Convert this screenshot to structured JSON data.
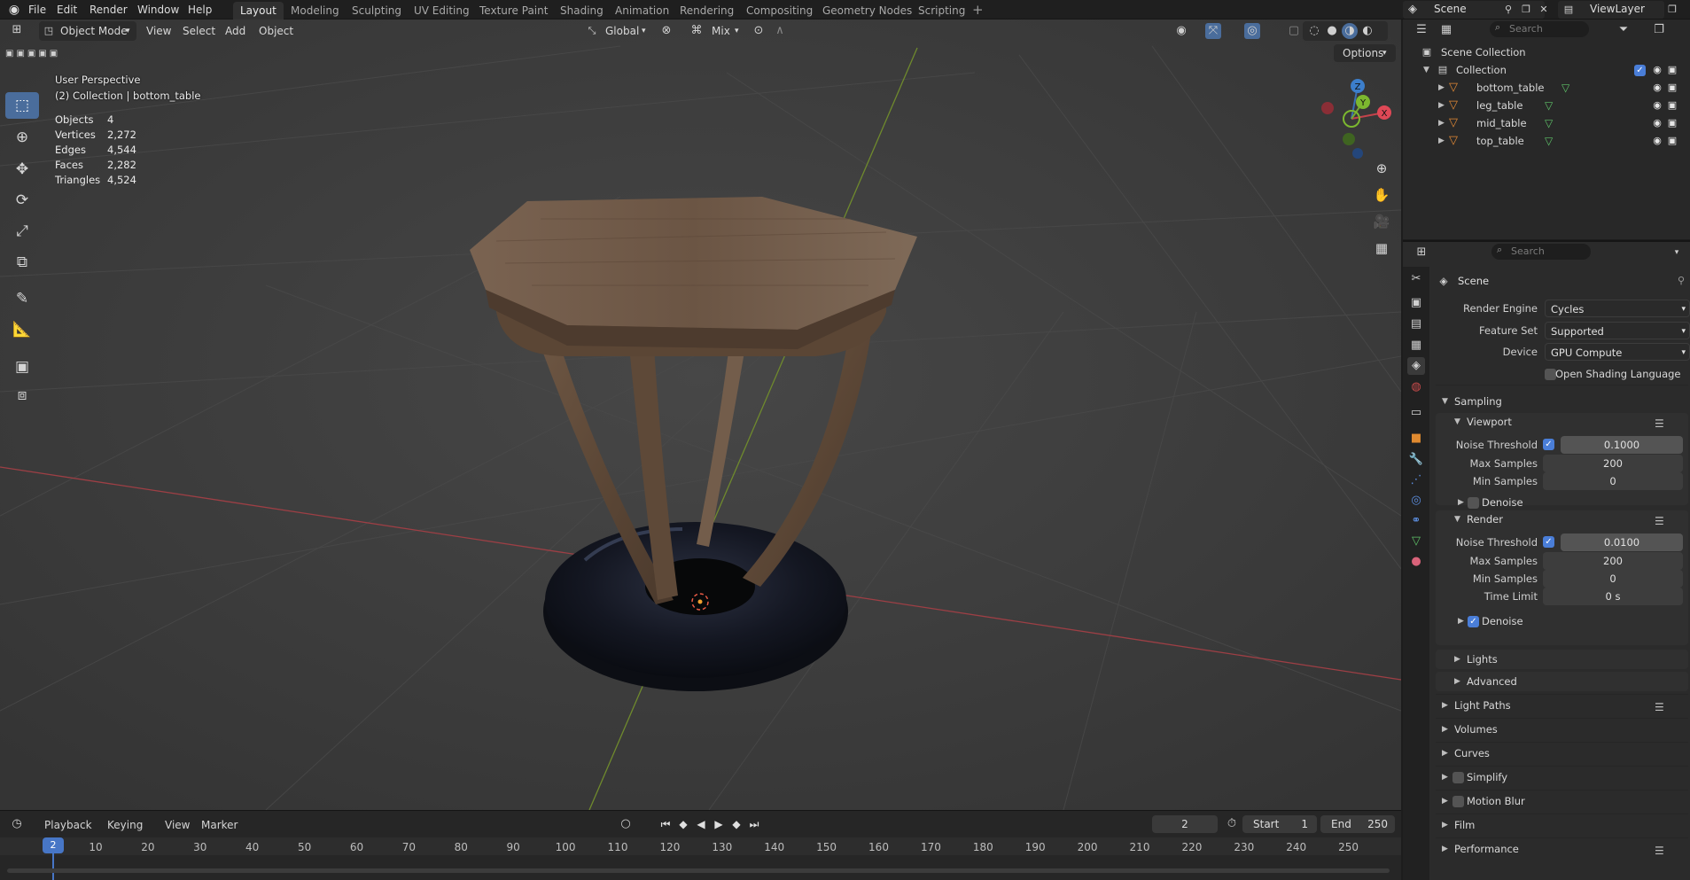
{
  "menu": {
    "items": [
      "File",
      "Edit",
      "Render",
      "Window",
      "Help"
    ],
    "workspaces": [
      "Layout",
      "Modeling",
      "Sculpting",
      "UV Editing",
      "Texture Paint",
      "Shading",
      "Animation",
      "Rendering",
      "Compositing",
      "Geometry Nodes",
      "Scripting"
    ],
    "active_workspace": "Layout",
    "scene": "Scene",
    "view_layer": "ViewLayer"
  },
  "viewport_header": {
    "mode": "Object Mode",
    "menus": [
      "View",
      "Select",
      "Add",
      "Object"
    ],
    "transform_orientation": "Global",
    "snap_mode": "Mix",
    "options_label": "Options"
  },
  "viewport_overlay": {
    "perspective": "User Perspective",
    "collection": "(2) Collection | bottom_table",
    "stats": [
      {
        "label": "Objects",
        "value": "4"
      },
      {
        "label": "Vertices",
        "value": "2,272"
      },
      {
        "label": "Edges",
        "value": "4,544"
      },
      {
        "label": "Faces",
        "value": "2,282"
      },
      {
        "label": "Triangles",
        "value": "4,524"
      }
    ],
    "gizmo": {
      "x": "X",
      "y": "Y",
      "z": "Z"
    }
  },
  "outliner": {
    "search_placeholder": "Search",
    "scene_collection": "Scene Collection",
    "collection": "Collection",
    "objects": [
      "bottom_table",
      "leg_table",
      "mid_table",
      "top_table"
    ]
  },
  "properties": {
    "search_placeholder": "Search",
    "context": "Scene",
    "render_engine_label": "Render Engine",
    "render_engine": "Cycles",
    "feature_set_label": "Feature Set",
    "feature_set": "Supported",
    "device_label": "Device",
    "device": "GPU Compute",
    "osl_label": "Open Shading Language",
    "sampling": "Sampling",
    "viewport": "Viewport",
    "vp_noise_label": "Noise Threshold",
    "vp_noise": "0.1000",
    "vp_max_label": "Max Samples",
    "vp_max": "200",
    "vp_min_label": "Min Samples",
    "vp_min": "0",
    "vp_denoise": "Denoise",
    "render": "Render",
    "r_noise_label": "Noise Threshold",
    "r_noise": "0.0100",
    "r_max_label": "Max Samples",
    "r_max": "200",
    "r_min_label": "Min Samples",
    "r_min": "0",
    "r_time_label": "Time Limit",
    "r_time": "0 s",
    "r_denoise": "Denoise",
    "lights": "Lights",
    "advanced": "Advanced",
    "light_paths": "Light Paths",
    "volumes": "Volumes",
    "curves": "Curves",
    "simplify": "Simplify",
    "motion_blur": "Motion Blur",
    "film": "Film",
    "performance": "Performance"
  },
  "timeline": {
    "menus": [
      "Playback",
      "Keying",
      "View",
      "Marker"
    ],
    "current_frame": "2",
    "start_label": "Start",
    "start": "1",
    "end_label": "End",
    "end": "250",
    "ticks": [
      "10",
      "20",
      "30",
      "40",
      "50",
      "60",
      "70",
      "80",
      "90",
      "100",
      "110",
      "120",
      "130",
      "140",
      "150",
      "160",
      "170",
      "180",
      "190",
      "200",
      "210",
      "220",
      "230",
      "240",
      "250"
    ],
    "playhead": "2"
  }
}
